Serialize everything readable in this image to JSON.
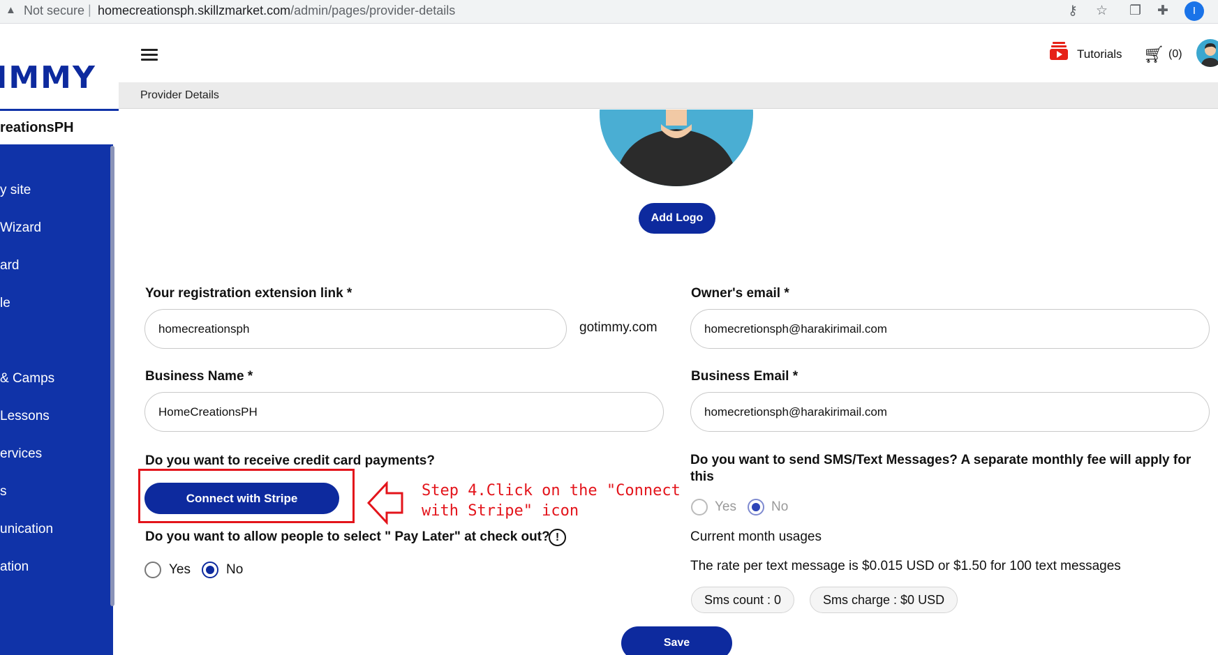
{
  "browser": {
    "security_label": "Not secure",
    "url_host": "homecreationsph.skillzmarket.com",
    "url_path": "/admin/pages/provider-details",
    "profile_initial": "I"
  },
  "sidebar": {
    "logo_text": "IMMY",
    "site_name": "reationsPH",
    "items": [
      {
        "label": "y site"
      },
      {
        "label": "Wizard"
      },
      {
        "label": "ard"
      },
      {
        "label": "le"
      },
      {
        "label": "& Camps"
      },
      {
        "label": "Lessons"
      },
      {
        "label": "ervices"
      },
      {
        "label": "s"
      },
      {
        "label": "unication"
      },
      {
        "label": "ation"
      }
    ]
  },
  "header": {
    "tutorials_label": "Tutorials",
    "cart_count": "(0)",
    "breadcrumb": "Provider Details"
  },
  "logo_section": {
    "add_logo_label": "Add Logo"
  },
  "form": {
    "registration_link": {
      "label": "Your registration extension link *",
      "value": "homecreationsph",
      "suffix": "gotimmy.com"
    },
    "owner_email": {
      "label": "Owner's email *",
      "value": "homecretionsph@harakirimail.com"
    },
    "business_name": {
      "label": "Business Name *",
      "value": "HomeCreationsPH"
    },
    "business_email": {
      "label": "Business Email *",
      "value": "homecretionsph@harakirimail.com"
    },
    "credit_card_question": "Do you want to receive credit card payments?",
    "connect_stripe_label": "Connect with Stripe",
    "pay_later_question": "Do you want to allow people to select \" Pay Later\" at check out?",
    "pay_later_options": {
      "yes": "Yes",
      "no": "No",
      "selected": "No"
    },
    "sms_question": "Do you want to send SMS/Text Messages? A separate monthly fee will apply for this",
    "sms_options": {
      "yes": "Yes",
      "no": "No",
      "selected": "No"
    },
    "current_usage_label": "Current month usages",
    "rate_text": "The rate per text message is $0.015 USD or $1.50 for 100 text messages",
    "sms_count": "Sms count : 0",
    "sms_charge": "Sms charge : $0 USD",
    "save_label": "Save"
  },
  "annotation": {
    "line1": "Step 4.Click on the \"Connect",
    "line2": "with Stripe\" icon",
    "color": "#e3141b"
  },
  "colors": {
    "brand": "#0d2a9e",
    "sidebar": "#1033a8",
    "annotation": "#e3141b"
  }
}
